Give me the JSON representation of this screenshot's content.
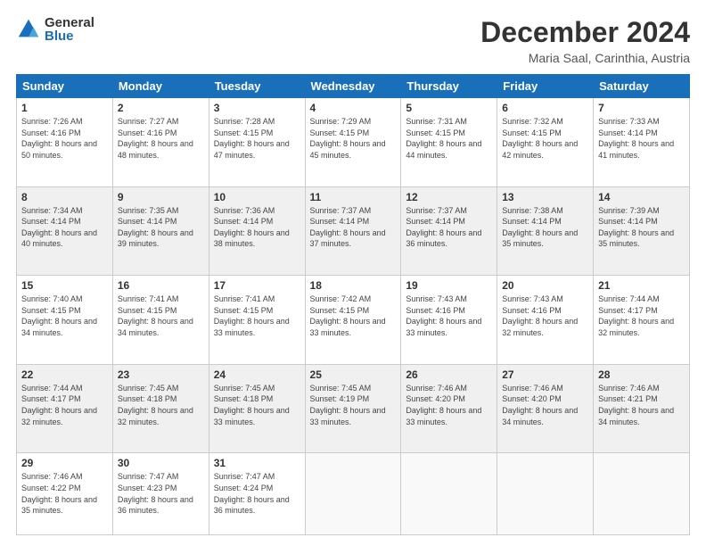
{
  "logo": {
    "general": "General",
    "blue": "Blue"
  },
  "title": "December 2024",
  "location": "Maria Saal, Carinthia, Austria",
  "weekdays": [
    "Sunday",
    "Monday",
    "Tuesday",
    "Wednesday",
    "Thursday",
    "Friday",
    "Saturday"
  ],
  "weeks": [
    [
      {
        "day": "1",
        "sunrise": "Sunrise: 7:26 AM",
        "sunset": "Sunset: 4:16 PM",
        "daylight": "Daylight: 8 hours and 50 minutes."
      },
      {
        "day": "2",
        "sunrise": "Sunrise: 7:27 AM",
        "sunset": "Sunset: 4:16 PM",
        "daylight": "Daylight: 8 hours and 48 minutes."
      },
      {
        "day": "3",
        "sunrise": "Sunrise: 7:28 AM",
        "sunset": "Sunset: 4:15 PM",
        "daylight": "Daylight: 8 hours and 47 minutes."
      },
      {
        "day": "4",
        "sunrise": "Sunrise: 7:29 AM",
        "sunset": "Sunset: 4:15 PM",
        "daylight": "Daylight: 8 hours and 45 minutes."
      },
      {
        "day": "5",
        "sunrise": "Sunrise: 7:31 AM",
        "sunset": "Sunset: 4:15 PM",
        "daylight": "Daylight: 8 hours and 44 minutes."
      },
      {
        "day": "6",
        "sunrise": "Sunrise: 7:32 AM",
        "sunset": "Sunset: 4:15 PM",
        "daylight": "Daylight: 8 hours and 42 minutes."
      },
      {
        "day": "7",
        "sunrise": "Sunrise: 7:33 AM",
        "sunset": "Sunset: 4:14 PM",
        "daylight": "Daylight: 8 hours and 41 minutes."
      }
    ],
    [
      {
        "day": "8",
        "sunrise": "Sunrise: 7:34 AM",
        "sunset": "Sunset: 4:14 PM",
        "daylight": "Daylight: 8 hours and 40 minutes."
      },
      {
        "day": "9",
        "sunrise": "Sunrise: 7:35 AM",
        "sunset": "Sunset: 4:14 PM",
        "daylight": "Daylight: 8 hours and 39 minutes."
      },
      {
        "day": "10",
        "sunrise": "Sunrise: 7:36 AM",
        "sunset": "Sunset: 4:14 PM",
        "daylight": "Daylight: 8 hours and 38 minutes."
      },
      {
        "day": "11",
        "sunrise": "Sunrise: 7:37 AM",
        "sunset": "Sunset: 4:14 PM",
        "daylight": "Daylight: 8 hours and 37 minutes."
      },
      {
        "day": "12",
        "sunrise": "Sunrise: 7:37 AM",
        "sunset": "Sunset: 4:14 PM",
        "daylight": "Daylight: 8 hours and 36 minutes."
      },
      {
        "day": "13",
        "sunrise": "Sunrise: 7:38 AM",
        "sunset": "Sunset: 4:14 PM",
        "daylight": "Daylight: 8 hours and 35 minutes."
      },
      {
        "day": "14",
        "sunrise": "Sunrise: 7:39 AM",
        "sunset": "Sunset: 4:14 PM",
        "daylight": "Daylight: 8 hours and 35 minutes."
      }
    ],
    [
      {
        "day": "15",
        "sunrise": "Sunrise: 7:40 AM",
        "sunset": "Sunset: 4:15 PM",
        "daylight": "Daylight: 8 hours and 34 minutes."
      },
      {
        "day": "16",
        "sunrise": "Sunrise: 7:41 AM",
        "sunset": "Sunset: 4:15 PM",
        "daylight": "Daylight: 8 hours and 34 minutes."
      },
      {
        "day": "17",
        "sunrise": "Sunrise: 7:41 AM",
        "sunset": "Sunset: 4:15 PM",
        "daylight": "Daylight: 8 hours and 33 minutes."
      },
      {
        "day": "18",
        "sunrise": "Sunrise: 7:42 AM",
        "sunset": "Sunset: 4:15 PM",
        "daylight": "Daylight: 8 hours and 33 minutes."
      },
      {
        "day": "19",
        "sunrise": "Sunrise: 7:43 AM",
        "sunset": "Sunset: 4:16 PM",
        "daylight": "Daylight: 8 hours and 33 minutes."
      },
      {
        "day": "20",
        "sunrise": "Sunrise: 7:43 AM",
        "sunset": "Sunset: 4:16 PM",
        "daylight": "Daylight: 8 hours and 32 minutes."
      },
      {
        "day": "21",
        "sunrise": "Sunrise: 7:44 AM",
        "sunset": "Sunset: 4:17 PM",
        "daylight": "Daylight: 8 hours and 32 minutes."
      }
    ],
    [
      {
        "day": "22",
        "sunrise": "Sunrise: 7:44 AM",
        "sunset": "Sunset: 4:17 PM",
        "daylight": "Daylight: 8 hours and 32 minutes."
      },
      {
        "day": "23",
        "sunrise": "Sunrise: 7:45 AM",
        "sunset": "Sunset: 4:18 PM",
        "daylight": "Daylight: 8 hours and 32 minutes."
      },
      {
        "day": "24",
        "sunrise": "Sunrise: 7:45 AM",
        "sunset": "Sunset: 4:18 PM",
        "daylight": "Daylight: 8 hours and 33 minutes."
      },
      {
        "day": "25",
        "sunrise": "Sunrise: 7:45 AM",
        "sunset": "Sunset: 4:19 PM",
        "daylight": "Daylight: 8 hours and 33 minutes."
      },
      {
        "day": "26",
        "sunrise": "Sunrise: 7:46 AM",
        "sunset": "Sunset: 4:20 PM",
        "daylight": "Daylight: 8 hours and 33 minutes."
      },
      {
        "day": "27",
        "sunrise": "Sunrise: 7:46 AM",
        "sunset": "Sunset: 4:20 PM",
        "daylight": "Daylight: 8 hours and 34 minutes."
      },
      {
        "day": "28",
        "sunrise": "Sunrise: 7:46 AM",
        "sunset": "Sunset: 4:21 PM",
        "daylight": "Daylight: 8 hours and 34 minutes."
      }
    ],
    [
      {
        "day": "29",
        "sunrise": "Sunrise: 7:46 AM",
        "sunset": "Sunset: 4:22 PM",
        "daylight": "Daylight: 8 hours and 35 minutes."
      },
      {
        "day": "30",
        "sunrise": "Sunrise: 7:47 AM",
        "sunset": "Sunset: 4:23 PM",
        "daylight": "Daylight: 8 hours and 36 minutes."
      },
      {
        "day": "31",
        "sunrise": "Sunrise: 7:47 AM",
        "sunset": "Sunset: 4:24 PM",
        "daylight": "Daylight: 8 hours and 36 minutes."
      },
      null,
      null,
      null,
      null
    ]
  ]
}
